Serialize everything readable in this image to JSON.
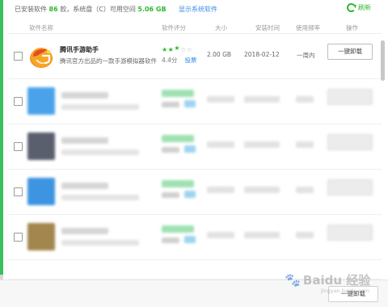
{
  "topbar": {
    "summary_prefix": "已安装软件",
    "installed_count": "86",
    "summary_mid": "款，系统盘（C）可用空间",
    "free_space": "5.06 GB",
    "show_system_link": "显示系统软件",
    "refresh_label": "刷新"
  },
  "columns": {
    "name": "软件名称",
    "rating": "软件评分",
    "size": "大小",
    "install_time": "安装时间",
    "frequency": "使用频率",
    "action": "操作"
  },
  "apps": [
    {
      "name": "腾讯手游助手",
      "description": "腾讯官方出品的一款手游模拟器软件",
      "score": "4.4分",
      "rate_link": "投票",
      "size": "2.00 GB",
      "install_date": "2018-02-12",
      "frequency": "一周内",
      "action_label": "一键卸载",
      "icon": "tencent-gameassist-icon",
      "stars_filled": 2.5,
      "stars_total": 5
    }
  ],
  "blurred_rows": [
    {
      "icon": "blurred-blue-app-icon",
      "icon_color": "#4aa3ea"
    },
    {
      "icon": "blurred-dark-app-icon",
      "icon_color": "#5a5f6e"
    },
    {
      "icon": "blurred-blue-app-icon",
      "icon_color": "#3d94e0"
    },
    {
      "icon": "blurred-gold-app-icon",
      "icon_color": "#a2864e"
    },
    {
      "icon": "blurred-red-app-icon",
      "icon_color": "#e4544a"
    },
    {
      "icon": "blurred-lightblue-app-icon",
      "icon_color": "#7cc0f2"
    }
  ],
  "footer": {
    "bulk_uninstall_label": "一键卸载"
  },
  "watermark": {
    "brand": "Baidu 经验",
    "url": "jingyan.baidu.com"
  },
  "colors": {
    "accent_green": "#2eb82e",
    "link_blue": "#3a8ee6"
  }
}
